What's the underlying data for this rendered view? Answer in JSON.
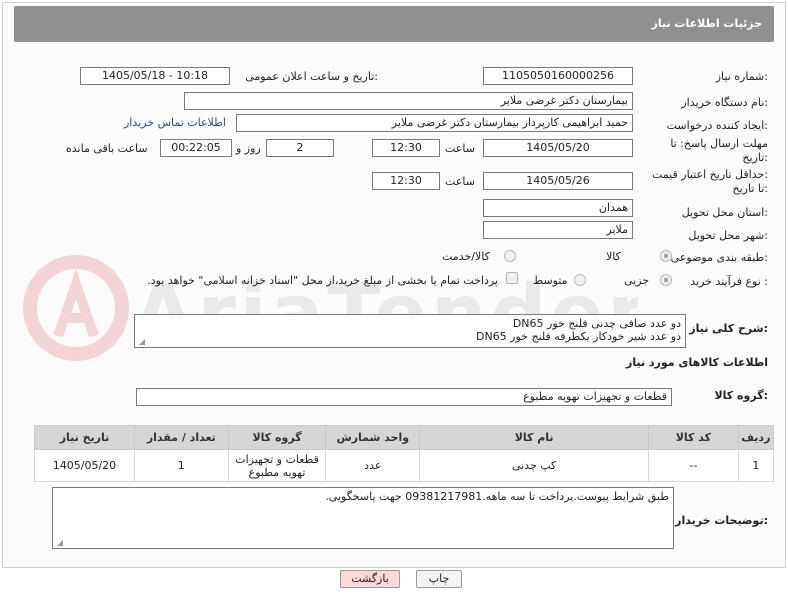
{
  "header": {
    "title": "جزئیات اطلاعات نیاز"
  },
  "fields": {
    "need_number_label": "شماره نیاز:",
    "need_number": "1105050160000256",
    "announce_label": "تاریخ و ساعت اعلان عمومی:",
    "announce_value": "1405/05/18 - 10:18",
    "buyer_org_label": "نام دستگاه خریدار:",
    "buyer_org": "بیمارستان دکتر غرضی ملایر",
    "creator_label": "ایجاد کننده درخواست:",
    "creator": "حمید ابراهیمی کارپرداز بیمارستان دکتر غرضی ملایر",
    "contact_link": "اطلاعات تماس خریدار",
    "deadline_label_1": "مهلت ارسال پاسخ: تا",
    "deadline_label_2": "تاریخ:",
    "deadline_date": "1405/05/20",
    "time_label": "ساعت",
    "deadline_time": "12:30",
    "days_value": "2",
    "days_label": "روز و",
    "remaining_time": "00:22:05",
    "remaining_label": "ساعت باقی مانده",
    "price_valid_label_1": "حداقل تاریخ اعتبار قیمت:",
    "price_valid_label_2": "تا تاریخ:",
    "price_valid_date": "1405/05/26",
    "price_valid_time": "12:30",
    "province_label": "استان محل تحویل:",
    "province": "همدان",
    "city_label": "شهر محل تحویل:",
    "city": "ملایر",
    "category_label": "طبقه بندی موضوعی:",
    "category_goods": "کالا",
    "category_goods_service": "کالا/خدمت",
    "process_label": "نوع فرآیند خرید :",
    "process_minor": "جزیی",
    "process_medium": "متوسط",
    "process_note": "پرداخت تمام یا بخشی از مبلغ خرید،از محل \"اسناد خزانه اسلامی\" خواهد بود."
  },
  "description": {
    "label": "شرح کلی نیاز:",
    "line1": "دو عدد صافی چدنی فلنج خور DN65",
    "line2": "دو عدد شیر خودکار یکطرفه فلنج خور DN65"
  },
  "goods_info": {
    "title": "اطلاعات کالاهای مورد نیاز",
    "group_label": "گروه کالا:",
    "group_value": "قطعات و تجهیزات تهویه مطبوع"
  },
  "table": {
    "headers": [
      "ردیف",
      "کد کالا",
      "نام کالا",
      "واحد شمارش",
      "گروه کالا",
      "تعداد / مقدار",
      "تاریخ نیاز"
    ],
    "rows": [
      [
        "1",
        "--",
        "کپ چدنی",
        "عدد",
        "قطعات و تجهیزات تهویه مطبوع",
        "1",
        "1405/05/20"
      ]
    ]
  },
  "buyer_notes": {
    "label": "توضیحات خریدار:",
    "text": "طبق شرایط پیوست.پرداخت تا سه ماهه.09381217981 جهت پاسخگویی."
  },
  "buttons": {
    "print": "چاپ",
    "back": "بازگشت"
  },
  "colors": {
    "header_bg": "#8f8f8f",
    "link": "#1a4fa0",
    "back_btn_bg": "#f7d9d9"
  }
}
